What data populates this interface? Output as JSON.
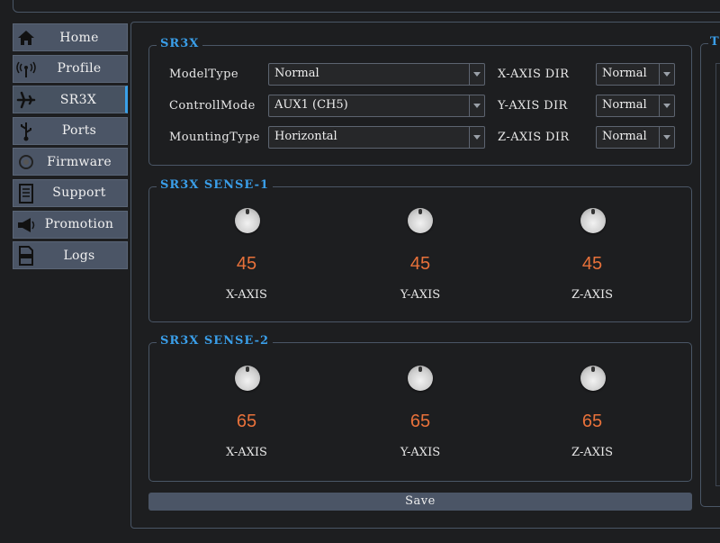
{
  "sidebar": {
    "items": [
      {
        "label": "Home",
        "icon": "home-icon"
      },
      {
        "label": "Profile",
        "icon": "radio-signal-icon"
      },
      {
        "label": "SR3X",
        "icon": "airplane-icon",
        "active": true
      },
      {
        "label": "Ports",
        "icon": "usb-icon"
      },
      {
        "label": "Firmware",
        "icon": "chip-icon"
      },
      {
        "label": "Support",
        "icon": "document-icon"
      },
      {
        "label": "Promotion",
        "icon": "megaphone-icon"
      },
      {
        "label": "Logs",
        "icon": "log-file-icon"
      }
    ]
  },
  "sr3x": {
    "title": "SR3X",
    "model_type": {
      "label": "ModelType",
      "value": "Normal"
    },
    "control_mode": {
      "label": "ControllMode",
      "value": "AUX1 (CH5)"
    },
    "mounting_type": {
      "label": "MountingType",
      "value": "Horizontal"
    },
    "x_axis_dir": {
      "label": "X-AXIS DIR",
      "value": "Normal"
    },
    "y_axis_dir": {
      "label": "Y-AXIS DIR",
      "value": "Normal"
    },
    "z_axis_dir": {
      "label": "Z-AXIS DIR",
      "value": "Normal"
    }
  },
  "sense1": {
    "title": "SR3X SENSE-1",
    "knobs": [
      {
        "value": "45",
        "label": "X-AXIS"
      },
      {
        "value": "45",
        "label": "Y-AXIS"
      },
      {
        "value": "45",
        "label": "Z-AXIS"
      }
    ]
  },
  "sense2": {
    "title": "SR3X SENSE-2",
    "knobs": [
      {
        "value": "65",
        "label": "X-AXIS"
      },
      {
        "value": "65",
        "label": "Y-AXIS"
      },
      {
        "value": "65",
        "label": "Z-AXIS"
      }
    ]
  },
  "save_label": "Save",
  "right_panel": {
    "title_fragment": "T"
  },
  "colors": {
    "accent": "#3a9ee8",
    "value": "#e8713a",
    "button": "#4b5566",
    "background": "#1d1e20"
  }
}
